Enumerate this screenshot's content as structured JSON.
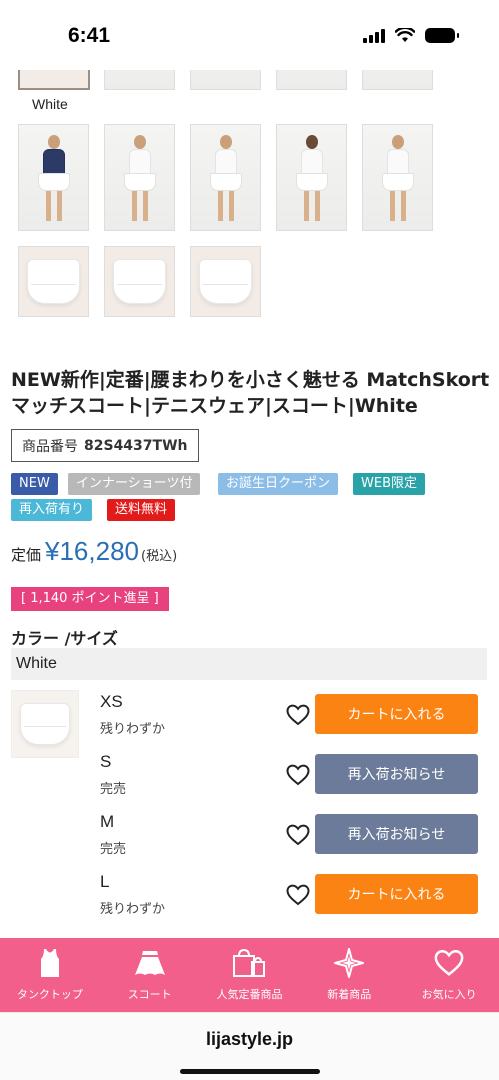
{
  "status": {
    "time": "6:41"
  },
  "gallery": {
    "top_color_label": "White"
  },
  "product": {
    "title": "NEW新作|定番|腰まわりを小さく魅せる MatchSkort マッチスコート|テニスウェア|スコート|White",
    "sku_label": "商品番号",
    "sku": "82S4437TWh"
  },
  "tags": [
    {
      "label": "NEW",
      "color": "#3a5ba8"
    },
    {
      "label": "インナーショーツ付",
      "color": "#b8b8b8"
    },
    {
      "label": "お誕生日クーポン",
      "color": "#8bbde6"
    },
    {
      "label": "WEB限定",
      "color": "#2aa3a8"
    },
    {
      "label": "再入荷有り",
      "color": "#4bb8d8"
    },
    {
      "label": "送料無料",
      "color": "#e31a1a"
    }
  ],
  "price": {
    "label": "定価",
    "value": "¥16,280",
    "tax": "(税込)"
  },
  "points": "[ 1,140 ポイント進呈 ]",
  "color_size": {
    "heading": "カラー /サイズ",
    "color": "White",
    "sizes": [
      {
        "size": "XS",
        "stock": "残りわずか",
        "button": "カートに入れる",
        "type": "cart"
      },
      {
        "size": "S",
        "stock": "完売",
        "button": "再入荷お知らせ",
        "type": "notify"
      },
      {
        "size": "M",
        "stock": "完売",
        "button": "再入荷お知らせ",
        "type": "notify"
      },
      {
        "size": "L",
        "stock": "残りわずか",
        "button": "カートに入れる",
        "type": "cart"
      }
    ]
  },
  "bottom_nav": [
    {
      "label": "タンクトップ",
      "icon": "tank-top-icon"
    },
    {
      "label": "スコート",
      "icon": "skirt-icon"
    },
    {
      "label": "人気定番商品",
      "icon": "shopping-bags-icon"
    },
    {
      "label": "新着商品",
      "icon": "sparkle-star-icon"
    },
    {
      "label": "お気に入り",
      "icon": "heart-icon"
    }
  ],
  "browser": {
    "url": "lijastyle.jp"
  },
  "colors": {
    "accent_pink": "#f25f8b",
    "price_blue": "#2a6fb5",
    "cart_orange": "#fb8313",
    "notify_slate": "#6b7b99"
  }
}
